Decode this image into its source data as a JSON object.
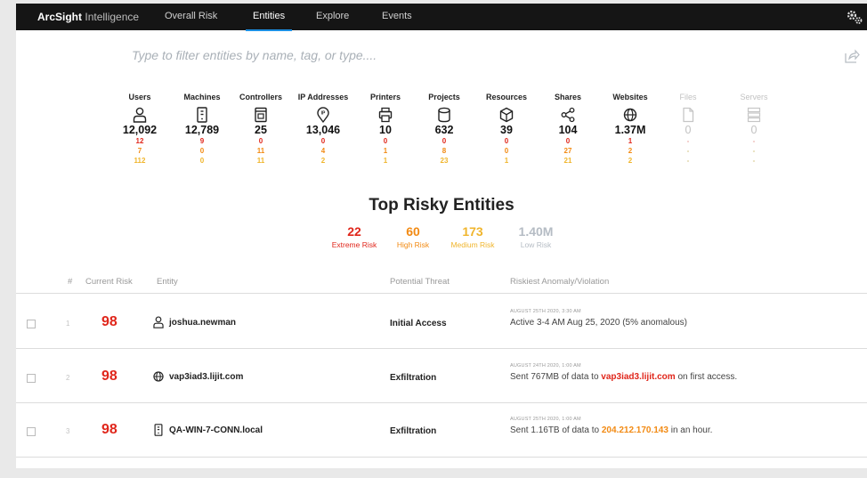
{
  "nav": {
    "brand_bold": "ArcSight",
    "brand_light": "Intelligence",
    "tabs": [
      {
        "label": "Overall Risk"
      },
      {
        "label": "Entities"
      },
      {
        "label": "Explore"
      },
      {
        "label": "Events"
      }
    ],
    "active_tab": "Entities"
  },
  "filter": {
    "placeholder": "Type to filter entities by name, tag, or type...."
  },
  "categories": [
    {
      "label": "Users",
      "icon": "user-icon",
      "total": "12,092",
      "extreme": "12",
      "high": "7",
      "medium": "112"
    },
    {
      "label": "Machines",
      "icon": "machine-icon",
      "total": "12,789",
      "extreme": "9",
      "high": "0",
      "medium": "0"
    },
    {
      "label": "Controllers",
      "icon": "controller-icon",
      "total": "25",
      "extreme": "0",
      "high": "11",
      "medium": "11"
    },
    {
      "label": "IP Addresses",
      "icon": "ip-pin-icon",
      "total": "13,046",
      "extreme": "0",
      "high": "4",
      "medium": "2"
    },
    {
      "label": "Printers",
      "icon": "printer-icon",
      "total": "10",
      "extreme": "0",
      "high": "1",
      "medium": "1"
    },
    {
      "label": "Projects",
      "icon": "database-icon",
      "total": "632",
      "extreme": "0",
      "high": "8",
      "medium": "23"
    },
    {
      "label": "Resources",
      "icon": "cube-icon",
      "total": "39",
      "extreme": "0",
      "high": "0",
      "medium": "1"
    },
    {
      "label": "Shares",
      "icon": "share-nodes-icon",
      "total": "104",
      "extreme": "0",
      "high": "27",
      "medium": "21"
    },
    {
      "label": "Websites",
      "icon": "globe-icon",
      "total": "1.37M",
      "extreme": "1",
      "high": "2",
      "medium": "2"
    },
    {
      "label": "Files",
      "icon": "file-icon",
      "total": "0",
      "extreme": "-",
      "high": "-",
      "medium": "-"
    },
    {
      "label": "Servers",
      "icon": "server-icon",
      "total": "0",
      "extreme": "-",
      "high": "-",
      "medium": "-"
    }
  ],
  "top_risky": {
    "title": "Top Risky Entities",
    "summary": [
      {
        "value": "22",
        "label": "Extreme Risk",
        "color": "#e0261b"
      },
      {
        "value": "60",
        "label": "High Risk",
        "color": "#f28a13"
      },
      {
        "value": "173",
        "label": "Medium Risk",
        "color": "#f0b52c"
      },
      {
        "value": "1.40M",
        "label": "Low Risk",
        "color": "#b5bcc4"
      }
    ]
  },
  "table": {
    "headers": {
      "index": "#",
      "risk": "Current Risk",
      "entity": "Entity",
      "threat": "Potential Threat",
      "anomaly": "Riskiest Anomaly/Violation"
    },
    "rows": [
      {
        "index": "1",
        "score": "98",
        "entity_icon": "user-icon",
        "entity": "joshua.newman",
        "threat": "Initial Access",
        "date": "AUGUST 25TH 2020, 3:30 AM",
        "desc_pre": "Active 3-4 AM Aug 25, 2020 (5% anomalous)",
        "desc_hl": "",
        "desc_post": ""
      },
      {
        "index": "2",
        "score": "98",
        "entity_icon": "globe-icon",
        "entity": "vap3iad3.lijit.com",
        "threat": "Exfiltration",
        "date": "AUGUST 24TH 2020, 1:00 AM",
        "desc_pre": "Sent 767MB of data to ",
        "desc_hl": "vap3iad3.lijit.com",
        "desc_post": " on first access."
      },
      {
        "index": "3",
        "score": "98",
        "entity_icon": "machine-icon",
        "entity": "QA-WIN-7-CONN.local",
        "threat": "Exfiltration",
        "date": "AUGUST 25TH 2020, 1:00 AM",
        "desc_pre": "Sent 1.16TB of data to ",
        "desc_hl": "204.212.170.143",
        "desc_post": " in an hour."
      }
    ]
  }
}
